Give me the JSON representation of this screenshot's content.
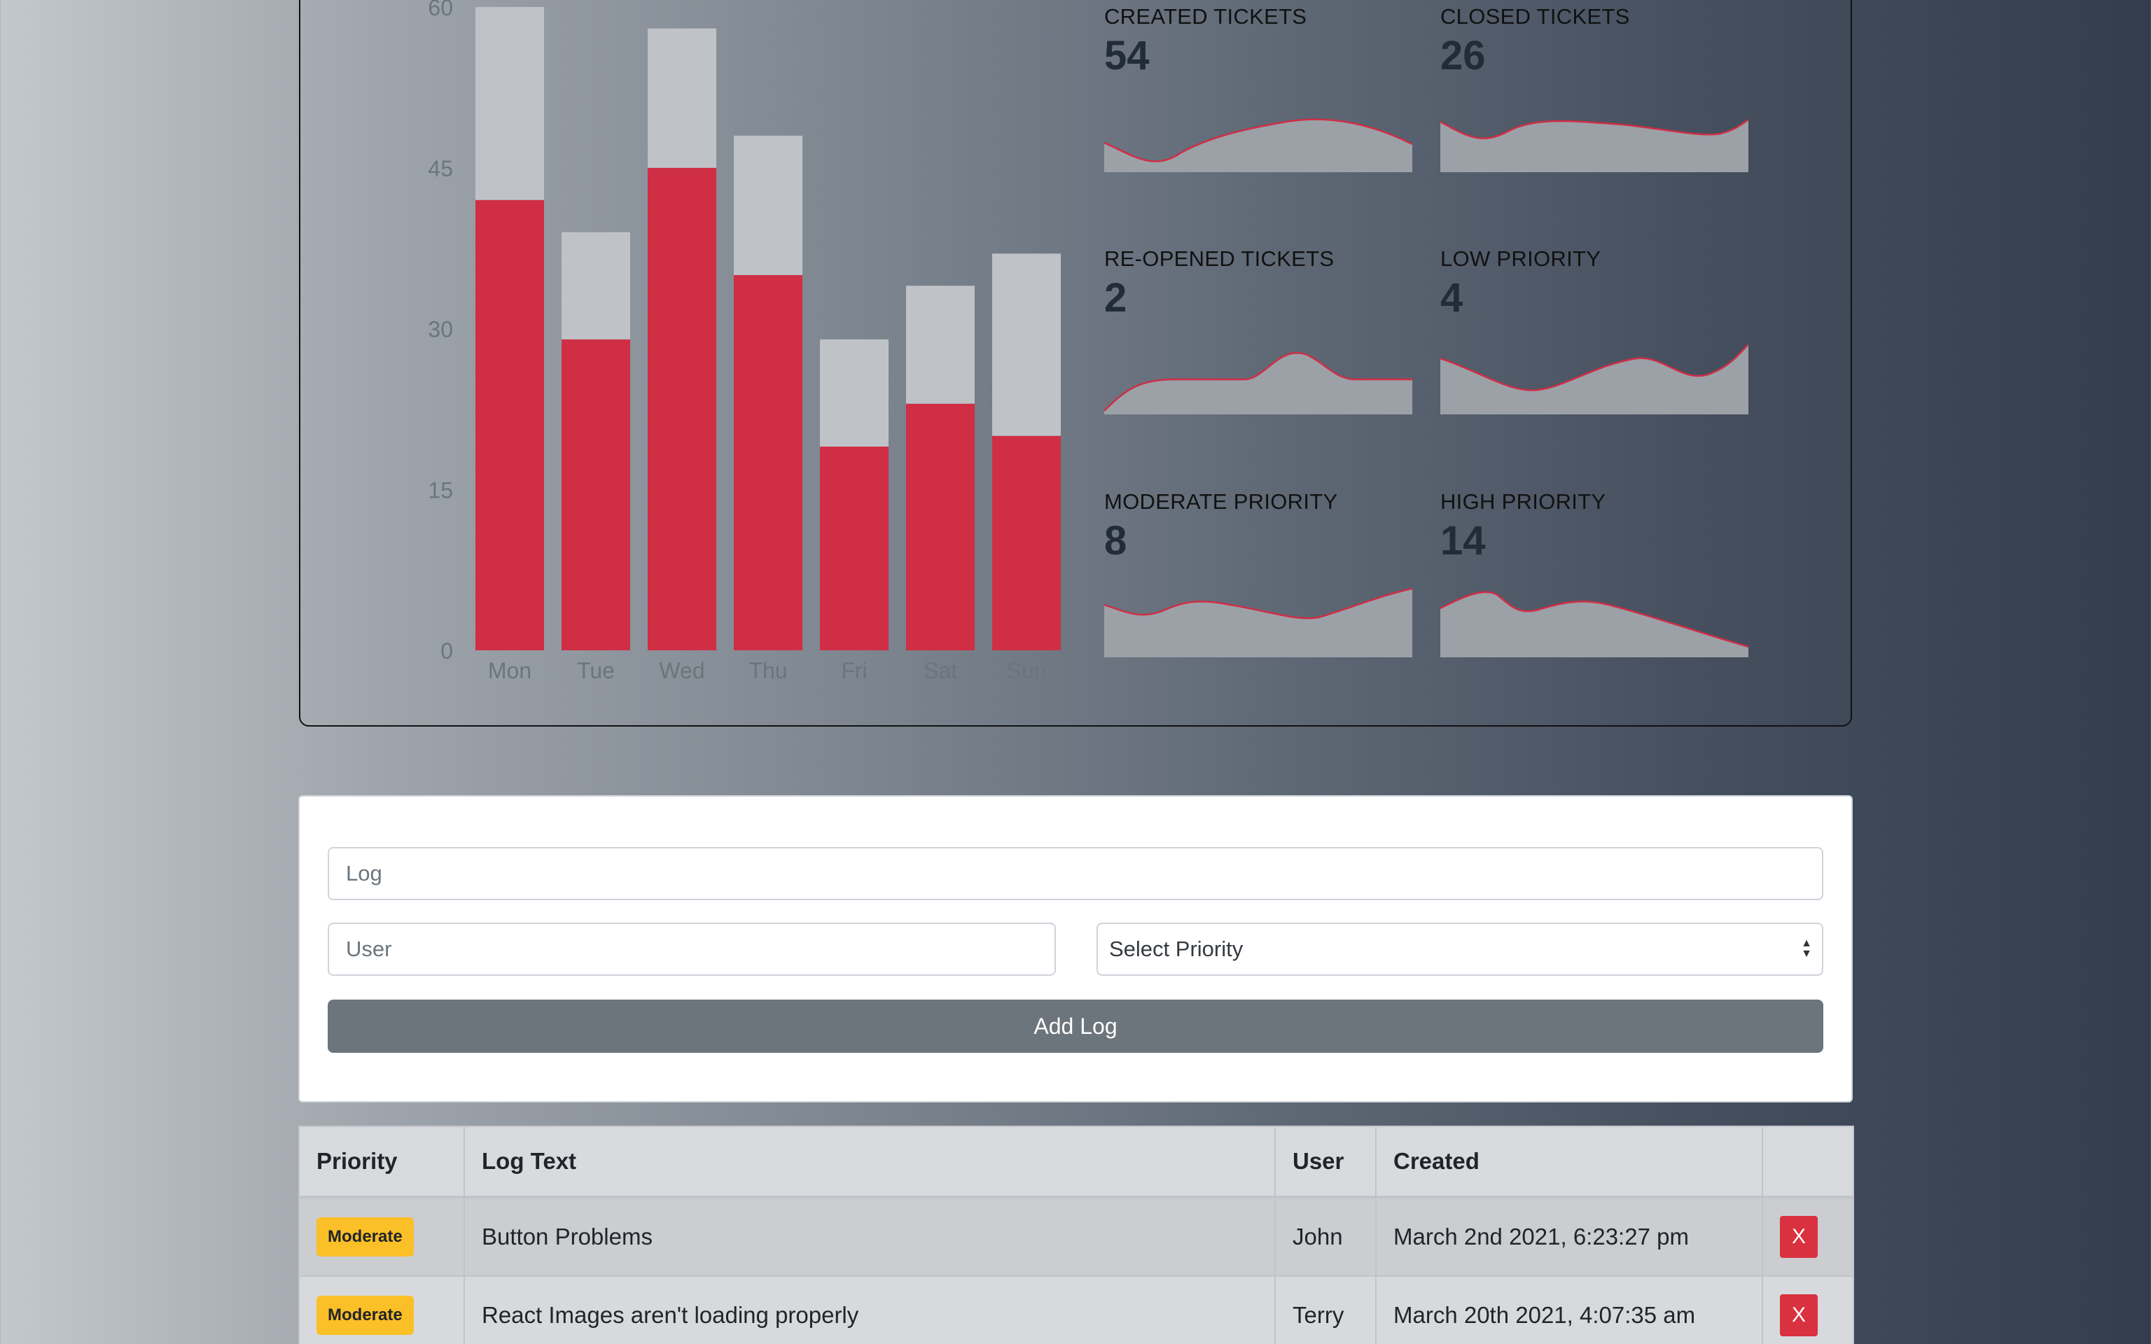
{
  "chart_data": {
    "type": "bar",
    "stacked": true,
    "categories": [
      "Mon",
      "Tue",
      "Wed",
      "Thu",
      "Fri",
      "Sat",
      "Sun"
    ],
    "series": [
      {
        "values": [
          42,
          29,
          45,
          35,
          19,
          23,
          20
        ],
        "color": "#cf2e45"
      },
      {
        "values": [
          18,
          10,
          13,
          13,
          10,
          11,
          17
        ],
        "color": "#bfc3c7"
      }
    ],
    "yticks": [
      0,
      15,
      30,
      45,
      60
    ],
    "ylim": [
      0,
      60
    ]
  },
  "stats": [
    {
      "label": "CREATED TICKETS",
      "value": "54"
    },
    {
      "label": "CLOSED TICKETS",
      "value": "26"
    },
    {
      "label": "RE-OPENED TICKETS",
      "value": "2"
    },
    {
      "label": "LOW PRIORITY",
      "value": "4"
    },
    {
      "label": "MODERATE PRIORITY",
      "value": "8"
    },
    {
      "label": "HIGH PRIORITY",
      "value": "14"
    }
  ],
  "form": {
    "log_placeholder": "Log",
    "user_placeholder": "User",
    "priority_selected": "Select Priority",
    "add_button": "Add Log"
  },
  "table": {
    "headers": [
      "Priority",
      "Log Text",
      "User",
      "Created",
      ""
    ],
    "rows": [
      {
        "priority": "Moderate",
        "text": "Button Problems",
        "user": "John",
        "created": "March 2nd 2021, 6:23:27 pm",
        "action": "X"
      },
      {
        "priority": "Moderate",
        "text": "React Images aren't loading properly",
        "user": "Terry",
        "created": "March 20th 2021, 4:07:35 am",
        "action": "X"
      }
    ]
  },
  "colors": {
    "bar_primary": "#cf2e45",
    "bar_secondary": "#bfc3c7",
    "badge_moderate": "#fbbf27",
    "delete_button": "#d9313f",
    "add_button": "#6c747c"
  }
}
